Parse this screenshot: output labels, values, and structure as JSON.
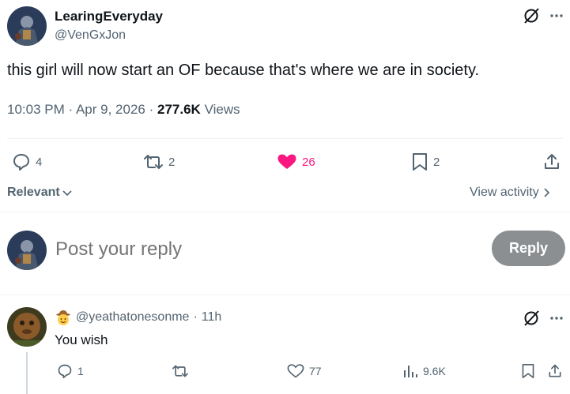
{
  "post": {
    "display_name": "LearingEveryday",
    "handle": "@VenGxJon",
    "text": "this girl will now start an OF because that's where we are in society.",
    "time": "10:03 PM",
    "date": "Apr 9, 2026",
    "views_count": "277.6K",
    "views_label": "Views",
    "replies": "4",
    "reposts": "2",
    "likes": "26",
    "bookmarks": "2",
    "like_color": "#f91880"
  },
  "sort": {
    "label": "Relevant",
    "view_activity": "View activity"
  },
  "composer": {
    "placeholder": "Post your reply",
    "reply_button": "Reply"
  },
  "reply": {
    "handle": "@yeathatonesonme",
    "age": "11h",
    "text": "You wish",
    "replies": "1",
    "likes": "77",
    "views": "9.6K"
  },
  "icons": [
    "grok-icon",
    "more-icon",
    "reply-icon",
    "repost-icon",
    "heart-icon",
    "bookmark-icon",
    "share-icon",
    "chevron-down-icon",
    "chevron-right-icon",
    "views-icon",
    "cowboy-emoji-icon"
  ]
}
